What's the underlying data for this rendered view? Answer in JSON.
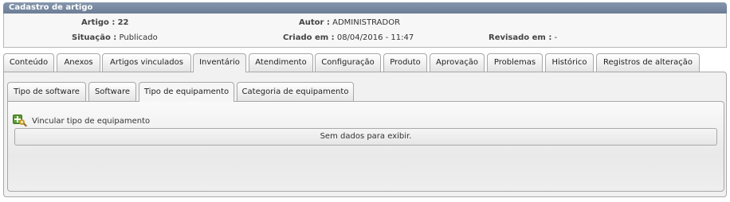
{
  "header": {
    "title": "Cadastro de artigo"
  },
  "info": {
    "artigo_label": "Artigo :",
    "artigo_value": "22",
    "autor_label": "Autor :",
    "autor_value": "ADMINISTRADOR",
    "situacao_label": "Situação :",
    "situacao_value": "Publicado",
    "criado_label": "Criado em :",
    "criado_value": "08/04/2016 - 11:47",
    "revisado_label": "Revisado em :",
    "revisado_value": "-"
  },
  "tabs": [
    {
      "label": "Conteúdo"
    },
    {
      "label": "Anexos"
    },
    {
      "label": "Artigos vinculados"
    },
    {
      "label": "Inventário"
    },
    {
      "label": "Atendimento"
    },
    {
      "label": "Configuração"
    },
    {
      "label": "Produto"
    },
    {
      "label": "Aprovação"
    },
    {
      "label": "Problemas"
    },
    {
      "label": "Histórico"
    },
    {
      "label": "Registros de alteração"
    }
  ],
  "active_tab": "Inventário",
  "subtabs": [
    {
      "label": "Tipo de software"
    },
    {
      "label": "Software"
    },
    {
      "label": "Tipo de equipamento"
    },
    {
      "label": "Categoria de equipamento"
    }
  ],
  "active_subtab": "Tipo de equipamento",
  "link": {
    "label": "Vincular tipo de equipamento",
    "icon": "add-search-icon"
  },
  "empty_message": "Sem dados para exibir.",
  "colors": {
    "header_bg": "#7687a0",
    "icon_green": "#5d9c34"
  }
}
